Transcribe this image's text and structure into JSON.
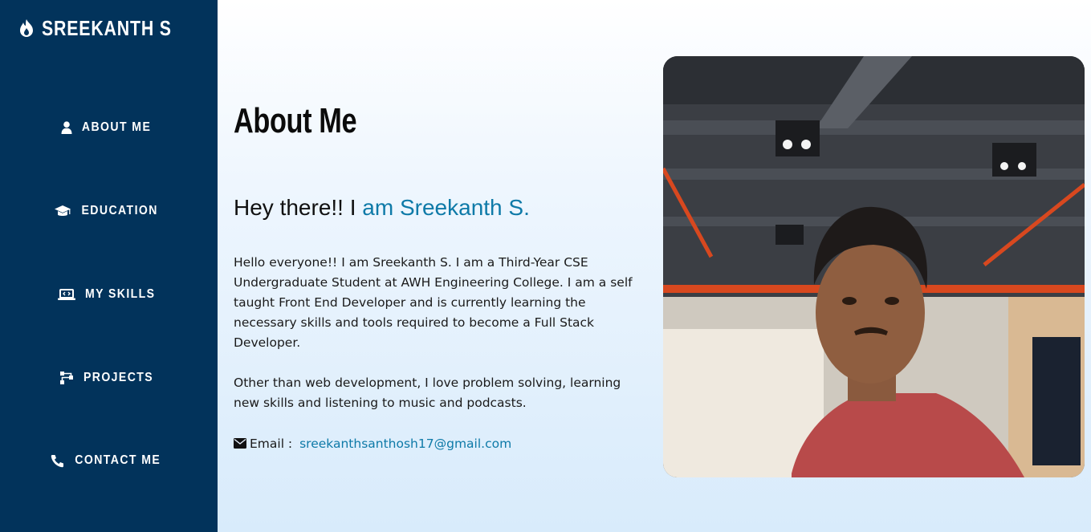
{
  "brand": {
    "name": "SREEKANTH S",
    "icon": "flame-icon"
  },
  "nav": {
    "items": [
      {
        "label": "ABOUT ME",
        "icon": "user-icon"
      },
      {
        "label": "EDUCATION",
        "icon": "graduation-cap-icon"
      },
      {
        "label": "MY SKILLS",
        "icon": "laptop-code-icon"
      },
      {
        "label": "PROJECTS",
        "icon": "project-diagram-icon"
      },
      {
        "label": "CONTACT ME",
        "icon": "phone-icon"
      }
    ]
  },
  "main": {
    "title": "About Me",
    "greeting_prefix": "Hey there!! I ",
    "greeting_highlight": "am Sreekanth S.",
    "paragraph1": "Hello everyone!! I am Sreekanth S. I am a Third-Year CSE Undergraduate Student at AWH Engineering College. I am a self taught Front End Developer and is currently learning the necessary skills and tools required to become a Full Stack Developer.",
    "paragraph2": "Other than web development, I love problem solving, learning new skills and listening to music and podcasts.",
    "email_label": "Email : ",
    "email": "sreekanthsanthosh17@gmail.com",
    "email_icon": "envelope-icon"
  },
  "colors": {
    "sidebar": "#02335b",
    "accent": "#0e7aa8",
    "text": "#1a1a1a"
  }
}
